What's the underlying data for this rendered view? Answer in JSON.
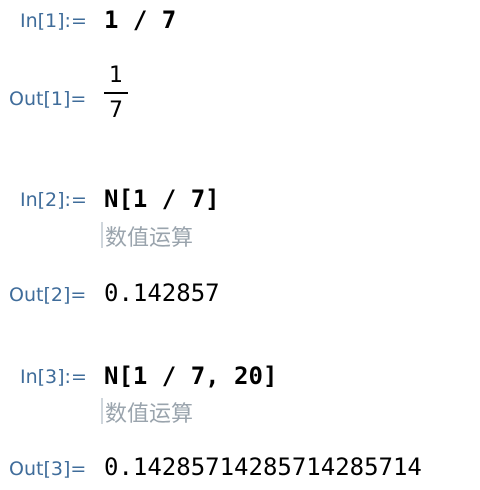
{
  "notebook": {
    "cells": [
      {
        "in_label": "In[1]:=",
        "input": "1 / 7",
        "out_label": "Out[1]=",
        "output_fraction": {
          "numerator": "1",
          "denominator": "7"
        }
      },
      {
        "in_label": "In[2]:=",
        "input": "N[1 / 7]",
        "hint": "数值运算",
        "out_label": "Out[2]=",
        "output": "0.142857"
      },
      {
        "in_label": "In[3]:=",
        "input": "N[1 / 7, 20]",
        "hint": "数值运算",
        "out_label": "Out[3]=",
        "output": "0.14285714285714285714"
      }
    ]
  }
}
